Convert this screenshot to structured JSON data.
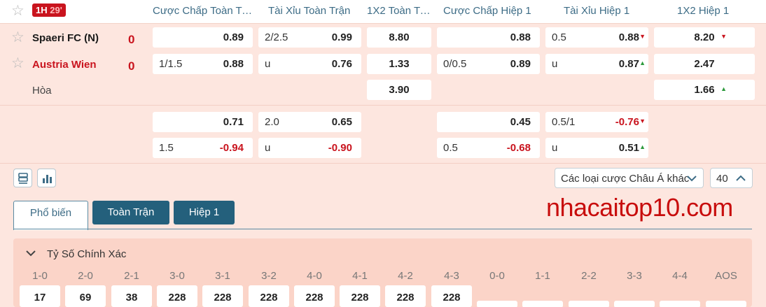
{
  "match": {
    "period": "1H",
    "minute": "29'",
    "home": "Spaeri FC (N)",
    "away": "Austria Wien",
    "home_score": "0",
    "away_score": "0",
    "draw_label": "Hòa",
    "home_color": "#1a1a1a",
    "away_color": "#c9141e"
  },
  "columns": [
    "Cược Chấp Toàn Trận",
    "Tài Xỉu Toàn Trận",
    "1X2 Toàn Trận",
    "Cược Chấp Hiệp 1",
    "Tài Xỉu Hiệp 1",
    "1X2 Hiệp 1"
  ],
  "odds": {
    "main": {
      "ah_ft": [
        {
          "label": "",
          "value": "0.89"
        },
        {
          "label": "1/1.5",
          "value": "0.88"
        }
      ],
      "ou_ft": [
        {
          "label": "2/2.5",
          "value": "0.99"
        },
        {
          "label": "u",
          "value": "0.76"
        }
      ],
      "x12_ft": [
        "8.80",
        "1.33",
        "3.90"
      ],
      "ah_1h": [
        {
          "label": "",
          "value": "0.88"
        },
        {
          "label": "0/0.5",
          "value": "0.89"
        }
      ],
      "ou_1h": [
        {
          "label": "0.5",
          "value": "0.88",
          "arrow": "down"
        },
        {
          "label": "u",
          "value": "0.87",
          "arrow": "up"
        }
      ],
      "x12_1h": [
        {
          "value": "8.20",
          "arrow": "down"
        },
        {
          "value": "2.47"
        },
        {
          "value": "1.66",
          "arrow": "up"
        }
      ]
    },
    "alt": {
      "ah_ft": [
        {
          "label": "",
          "value": "0.71"
        },
        {
          "label": "1.5",
          "value": "-0.94"
        }
      ],
      "ou_ft": [
        {
          "label": "2.0",
          "value": "0.65"
        },
        {
          "label": "u",
          "value": "-0.90"
        }
      ],
      "ah_1h": [
        {
          "label": "",
          "value": "0.45"
        },
        {
          "label": "0.5",
          "value": "-0.68"
        }
      ],
      "ou_1h": [
        {
          "label": "0.5/1",
          "value": "-0.76",
          "arrow": "down"
        },
        {
          "label": "u",
          "value": "0.51",
          "arrow": "up"
        }
      ]
    }
  },
  "controls": {
    "list_icon": "list-view-icon",
    "chart_icon": "bar-chart-icon",
    "market_select": "Các loại cược Châu Á khác",
    "page_size": "40"
  },
  "tabs": [
    "Phổ biến",
    "Toàn Trận",
    "Hiệp 1"
  ],
  "watermark": "nhacaitop10.com",
  "correct_score": {
    "title": "Tỷ Số Chính Xác",
    "labels": [
      "1-0",
      "2-0",
      "2-1",
      "3-0",
      "3-1",
      "3-2",
      "4-0",
      "4-1",
      "4-2",
      "4-3",
      "0-0",
      "1-1",
      "2-2",
      "3-3",
      "4-4",
      "AOS"
    ],
    "values": [
      "17",
      "69",
      "38",
      "228",
      "228",
      "228",
      "228",
      "228",
      "228",
      "228",
      "",
      "",
      "",
      "",
      "",
      ""
    ]
  },
  "colors": {
    "accent": "#3d6c86",
    "tab_dark": "#24607c",
    "negative": "#c9141e",
    "up": "#2d9a3c",
    "background": "#fde6df"
  }
}
